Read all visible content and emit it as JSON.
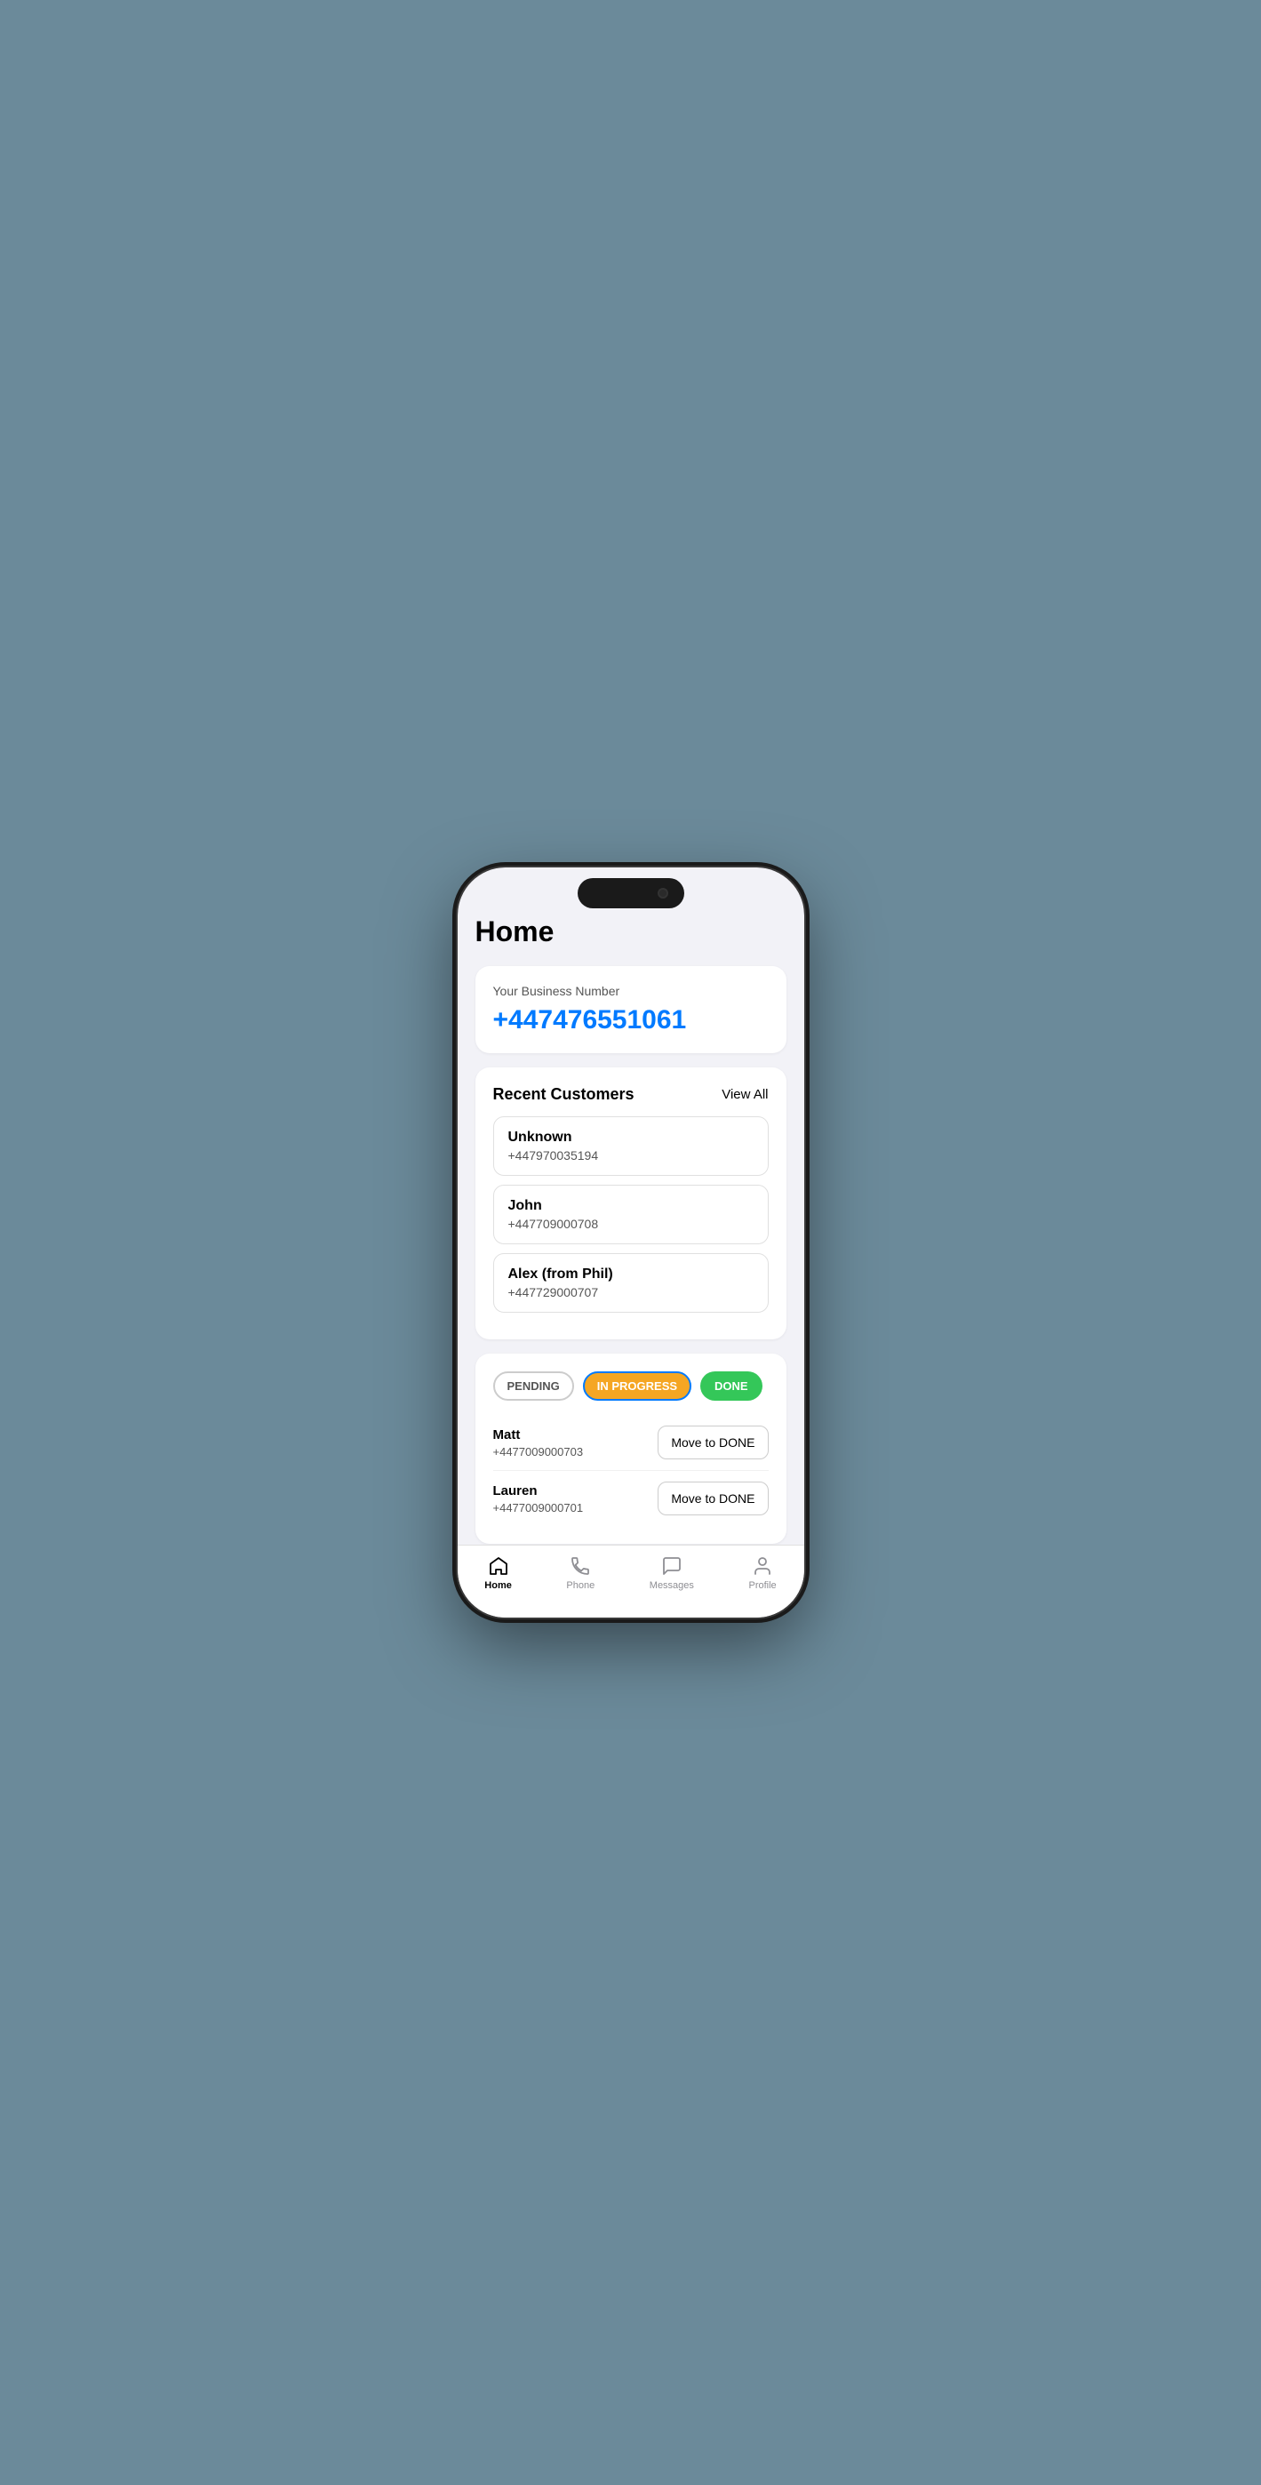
{
  "page": {
    "title": "Home"
  },
  "business": {
    "label": "Your Business Number",
    "number": "+447476551061"
  },
  "recentCustomers": {
    "sectionTitle": "Recent Customers",
    "viewAllLabel": "View All",
    "items": [
      {
        "name": "Unknown",
        "phone": "+447970035194"
      },
      {
        "name": "John",
        "phone": "+447709000708"
      },
      {
        "name": "Alex (from Phil)",
        "phone": "+447729000707"
      }
    ]
  },
  "pipeline": {
    "tabs": [
      {
        "label": "PENDING",
        "state": "pending"
      },
      {
        "label": "IN PROGRESS",
        "state": "inprogress"
      },
      {
        "label": "DONE",
        "state": "done"
      }
    ],
    "activeTab": "inprogress",
    "items": [
      {
        "name": "Matt",
        "phone": "+4477009000703",
        "action": "Move to DONE"
      },
      {
        "name": "Lauren",
        "phone": "+4477009000701",
        "action": "Move to DONE"
      }
    ]
  },
  "nav": {
    "items": [
      {
        "label": "Home",
        "icon": "home-icon",
        "active": true
      },
      {
        "label": "Phone",
        "icon": "phone-icon",
        "active": false
      },
      {
        "label": "Messages",
        "icon": "messages-icon",
        "active": false
      },
      {
        "label": "Profile",
        "icon": "profile-icon",
        "active": false
      }
    ]
  }
}
